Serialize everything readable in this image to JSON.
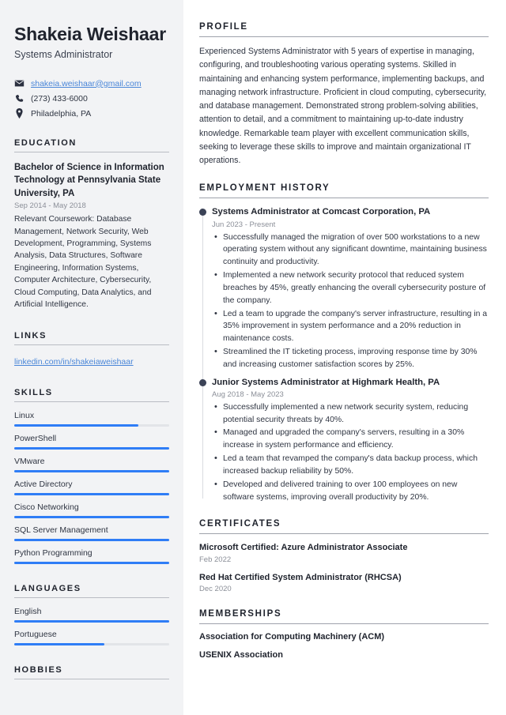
{
  "sidebar": {
    "name": "Shakeia Weishaar",
    "role": "Systems Administrator",
    "contact": {
      "email": "shakeia.weishaar@gmail.com",
      "phone": "(273) 433-6000",
      "location": "Philadelphia, PA",
      "email_icon": "envelope-icon",
      "phone_icon": "phone-icon",
      "location_icon": "map-pin-icon"
    },
    "education": {
      "title": "EDUCATION",
      "entries": [
        {
          "degree": "Bachelor of Science in Information Technology at Pennsylvania State University, PA",
          "date": "Sep 2014 - May 2018",
          "description": "Relevant Coursework: Database Management, Network Security, Web Development, Programming, Systems Analysis, Data Structures, Software Engineering, Information Systems, Computer Architecture, Cybersecurity, Cloud Computing, Data Analytics, and Artificial Intelligence."
        }
      ]
    },
    "links": {
      "title": "LINKS",
      "items": [
        {
          "label": "linkedin.com/in/shakeiaweishaar"
        }
      ]
    },
    "skills": {
      "title": "SKILLS",
      "items": [
        {
          "label": "Linux",
          "level": 80
        },
        {
          "label": "PowerShell",
          "level": 100
        },
        {
          "label": "VMware",
          "level": 100
        },
        {
          "label": "Active Directory",
          "level": 100
        },
        {
          "label": "Cisco Networking",
          "level": 100
        },
        {
          "label": "SQL Server Management",
          "level": 100
        },
        {
          "label": "Python Programming",
          "level": 100
        }
      ]
    },
    "languages": {
      "title": "LANGUAGES",
      "items": [
        {
          "label": "English",
          "level": 100
        },
        {
          "label": "Portuguese",
          "level": 58
        }
      ]
    },
    "hobbies": {
      "title": "HOBBIES"
    }
  },
  "main": {
    "profile": {
      "title": "PROFILE",
      "text": "Experienced Systems Administrator with 5 years of expertise in managing, configuring, and troubleshooting various operating systems. Skilled in maintaining and enhancing system performance, implementing backups, and managing network infrastructure. Proficient in cloud computing, cybersecurity, and database management. Demonstrated strong problem-solving abilities, attention to detail, and a commitment to maintaining up-to-date industry knowledge. Remarkable team player with excellent communication skills, seeking to leverage these skills to improve and maintain organizational IT operations."
    },
    "employment": {
      "title": "EMPLOYMENT HISTORY",
      "jobs": [
        {
          "title": "Systems Administrator at Comcast Corporation, PA",
          "date": "Jun 2023 - Present",
          "bullets": [
            "Successfully managed the migration of over 500 workstations to a new operating system without any significant downtime, maintaining business continuity and productivity.",
            "Implemented a new network security protocol that reduced system breaches by 45%, greatly enhancing the overall cybersecurity posture of the company.",
            "Led a team to upgrade the company's server infrastructure, resulting in a 35% improvement in system performance and a 20% reduction in maintenance costs.",
            "Streamlined the IT ticketing process, improving response time by 30% and increasing customer satisfaction scores by 25%."
          ]
        },
        {
          "title": "Junior Systems Administrator at Highmark Health, PA",
          "date": "Aug 2018 - May 2023",
          "bullets": [
            "Successfully implemented a new network security system, reducing potential security threats by 40%.",
            "Managed and upgraded the company's servers, resulting in a 30% increase in system performance and efficiency.",
            "Led a team that revamped the company's data backup process, which increased backup reliability by 50%.",
            "Developed and delivered training to over 100 employees on new software systems, improving overall productivity by 20%."
          ]
        }
      ]
    },
    "certificates": {
      "title": "CERTIFICATES",
      "items": [
        {
          "name": "Microsoft Certified: Azure Administrator Associate",
          "date": "Feb 2022"
        },
        {
          "name": "Red Hat Certified System Administrator (RHCSA)",
          "date": "Dec 2020"
        }
      ]
    },
    "memberships": {
      "title": "MEMBERSHIPS",
      "items": [
        {
          "name": "Association for Computing Machinery (ACM)"
        },
        {
          "name": "USENIX Association"
        }
      ]
    }
  },
  "theme": {
    "accent": "#2f7df6",
    "link": "#4a86d8",
    "heading": "#20242e",
    "body": "#2f3542",
    "muted": "#8b8f98",
    "sidebar_bg": "#f2f3f5",
    "marker": "#3b4256"
  }
}
